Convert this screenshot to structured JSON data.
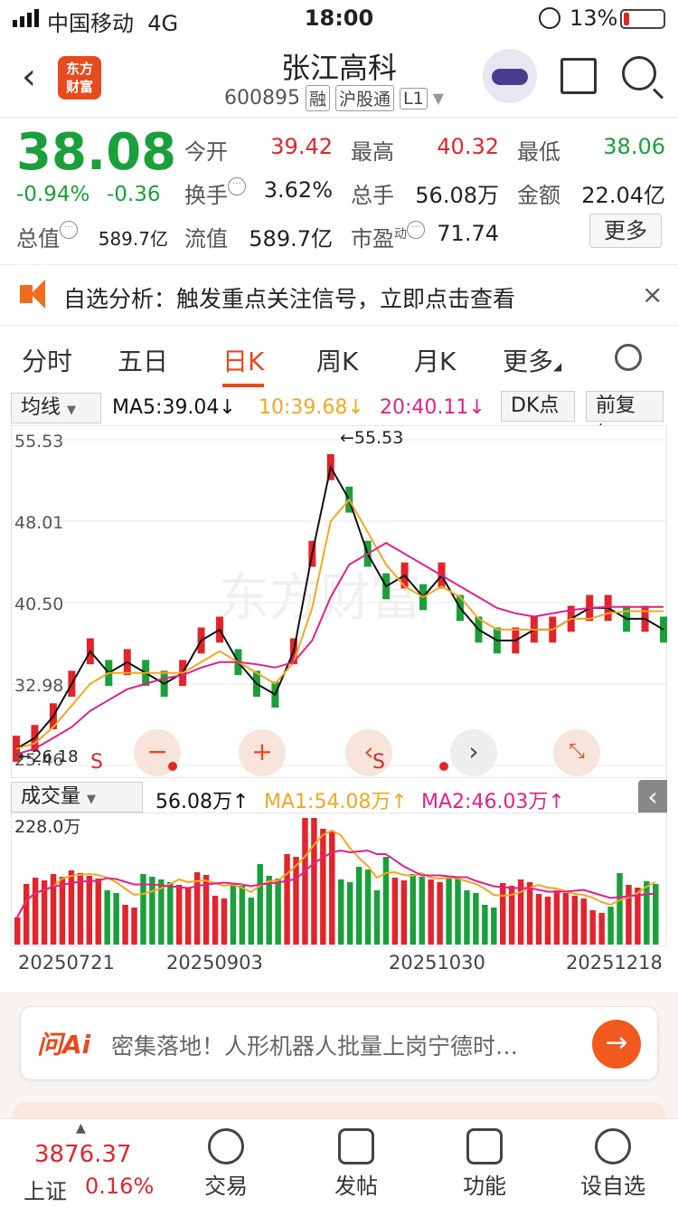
{
  "status": {
    "carrier": "中国移动",
    "network": "4G",
    "time": "18:00",
    "battery": "13%"
  },
  "header": {
    "title": "张江高科",
    "code": "600895",
    "tags": [
      "融",
      "沪股通",
      "L1"
    ],
    "logo_line1": "东方",
    "logo_line2": "财富"
  },
  "quote": {
    "price": "38.08",
    "pct": "-0.94%",
    "chg": "-0.36",
    "open_label": "今开",
    "open": "39.42",
    "high_label": "最高",
    "high": "40.32",
    "low_label": "最低",
    "low": "38.06",
    "turnover_label": "换手",
    "turnover": "3.62%",
    "volume_label": "总手",
    "volume": "56.08万",
    "amount_label": "金额",
    "amount": "22.04亿",
    "mcap_label": "总值",
    "mcap": "589.7亿",
    "float_label": "流值",
    "float": "589.7亿",
    "pe_label": "市盈",
    "pe_sup": "动",
    "pe": "71.74",
    "more": "更多"
  },
  "banner": {
    "text": "自选分析：触发重点关注信号，立即点击查看",
    "close": "×"
  },
  "tabs": [
    "分时",
    "五日",
    "日K",
    "周K",
    "月K",
    "更多"
  ],
  "toolbar": {
    "ma_select": "均线",
    "ma5": "MA5:39.04↓",
    "ma10": "10:39.68↓",
    "ma20": "20:40.11↓",
    "dk": "DK点",
    "fq": "前复权"
  },
  "colors": {
    "up": "#e3242b",
    "down": "#1aa03a",
    "ma5": "#111111",
    "ma10": "#f5a623",
    "ma20": "#e0218a",
    "accent": "#e8491d"
  },
  "chart_data": [
    {
      "type": "candlestick",
      "title": "",
      "y_ticks": [
        "55.53",
        "48.01",
        "40.50",
        "32.98",
        "25.46"
      ],
      "ylim": [
        25.46,
        55.53
      ],
      "annotations": [
        "←55.53",
        "←26.18"
      ],
      "series": [
        {
          "name": "MA5",
          "values": [
            27,
            28,
            30,
            33,
            36,
            34,
            35,
            34,
            33,
            34,
            37,
            38,
            35,
            33,
            32,
            36,
            45,
            53,
            50,
            45,
            42,
            43,
            41,
            43,
            40,
            38,
            37,
            37,
            38,
            38,
            39,
            40,
            40,
            39,
            39,
            38
          ]
        },
        {
          "name": "MA10",
          "values": [
            27,
            27.5,
            29,
            31,
            33,
            34,
            34,
            34,
            34,
            34,
            35,
            36,
            35,
            34,
            33,
            35,
            40,
            48,
            50,
            47,
            44,
            42,
            41,
            42,
            41,
            39,
            38,
            38,
            38,
            38,
            39,
            39,
            39.5,
            39.7,
            39.7,
            39.7
          ]
        },
        {
          "name": "MA20",
          "values": [
            26.5,
            27,
            28,
            29,
            30.5,
            31.5,
            32.5,
            33,
            33.5,
            33.8,
            34.5,
            35,
            35,
            34.8,
            34.5,
            35,
            37,
            41,
            44,
            45,
            46,
            45,
            44,
            43,
            42,
            41,
            40,
            39.5,
            39.2,
            39.5,
            39.8,
            40,
            40.1,
            40.1,
            40.1,
            40.1
          ]
        }
      ]
    },
    {
      "type": "bar",
      "title": "",
      "y_ticks": [
        "228.0万"
      ],
      "x_ticks": [
        "20250721",
        "20250903",
        "20251030",
        "20251218"
      ],
      "series": [
        {
          "name": "MA1:54.08万",
          "values": []
        },
        {
          "name": "MA2:46.03万",
          "values": []
        }
      ]
    }
  ],
  "vol_toolbar": {
    "select": "成交量",
    "vol": "56.08万↑",
    "ma1": "MA1:54.08万↑",
    "ma2": "MA2:46.03万↑"
  },
  "float_buttons": {
    "s_label": "S",
    "minus": "−",
    "plus": "+",
    "left": "‹",
    "right": "›"
  },
  "ai": {
    "brand": "问Ai",
    "text": "密集落地！人形机器人批量上岗宁德时…",
    "go": "→"
  },
  "tabbar": {
    "index_value": "3876.37",
    "index_name": "上证",
    "index_pct": "0.16%",
    "items": [
      "交易",
      "发帖",
      "功能",
      "设自选"
    ]
  },
  "watermark": "东方财富"
}
